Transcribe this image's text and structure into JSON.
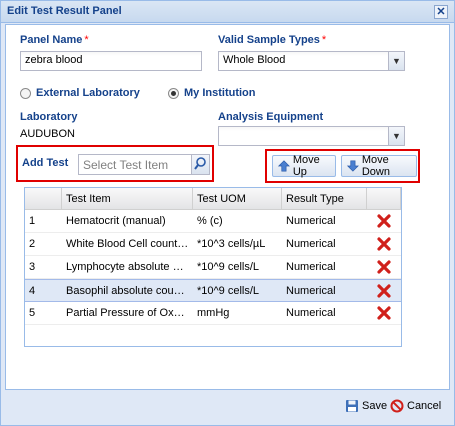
{
  "window": {
    "title": "Edit Test Result Panel"
  },
  "form": {
    "panel_name_label": "Panel Name",
    "panel_name_value": "zebra blood",
    "required_mark": "*",
    "sample_types_label": "Valid Sample Types",
    "sample_types_value": "Whole Blood",
    "radio_external_label": "External Laboratory",
    "radio_institution_label": "My Institution",
    "laboratory_label": "Laboratory",
    "laboratory_value": "AUDUBON",
    "equipment_label": "Analysis Equipment",
    "equipment_value": "",
    "add_test_label": "Add Test",
    "search_placeholder": "Select Test Item"
  },
  "toolbar": {
    "move_up_label": "Move Up",
    "move_down_label": "Move Down"
  },
  "grid": {
    "columns": [
      "",
      "Test Item",
      "Test UOM",
      "Result Type",
      ""
    ],
    "rows": [
      {
        "num": "1",
        "item": "Hematocrit (manual)",
        "uom": "% (c)",
        "type": "Numerical"
      },
      {
        "num": "2",
        "item": "White Blood Cell count (...",
        "uom": "*10^3 cells/µL",
        "type": "Numerical"
      },
      {
        "num": "3",
        "item": "Lymphocyte absolute co...",
        "uom": "*10^9 cells/L",
        "type": "Numerical"
      },
      {
        "num": "4",
        "item": "Basophil absolute count ...",
        "uom": "*10^9 cells/L",
        "type": "Numerical"
      },
      {
        "num": "5",
        "item": "Partial Pressure of Oxygen",
        "uom": "mmHg",
        "type": "Numerical"
      }
    ],
    "selected_row": "4"
  },
  "footer": {
    "save_label": "Save",
    "cancel_label": "Cancel"
  },
  "colors": {
    "title": "#15428b",
    "required": "#ff0000",
    "highlight_box": "#e00000",
    "delete_icon": "#d0201b"
  }
}
